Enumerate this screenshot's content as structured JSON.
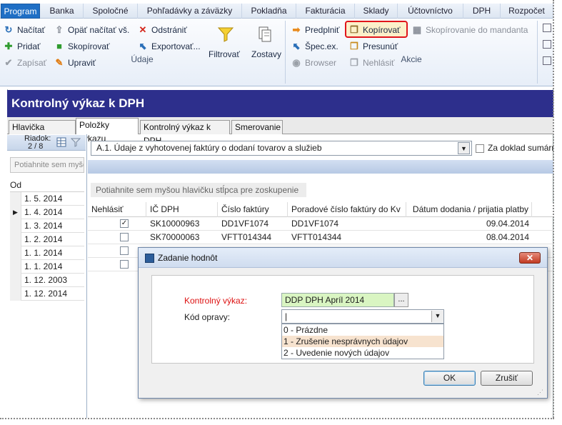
{
  "menu": {
    "tabs": [
      "Program",
      "Banka",
      "Spoločné",
      "Pohľadávky a záväzky",
      "Pokladňa",
      "Fakturácia",
      "Sklady",
      "Účtovníctvo",
      "DPH",
      "Rozpočet"
    ]
  },
  "ribbon": {
    "udaje": {
      "group_label": "Údaje",
      "nacitat": "Načítať",
      "opat_nacitat": "Opäť načítať vš.",
      "odstranit": "Odstrániť",
      "pridat": "Pridať",
      "skopirovat": "Skopírovať",
      "exportovat": "Exportovať...",
      "zapisat": "Zapísať",
      "upravit": "Upraviť",
      "filtrovat": "Filtrovať",
      "zostavy": "Zostavy"
    },
    "akcie": {
      "group_label": "Akcie",
      "predplnit": "Predplniť",
      "kopirovat": "Kopírovať",
      "skopirovanie_mandanta": "Skopírovanie do mandanta",
      "spec_ex": "Špec.ex.",
      "presunut": "Presunúť",
      "browser": "Browser",
      "nehlasit": "Nehlásiť"
    }
  },
  "page": {
    "title": "Kontrolný výkaz k DPH",
    "tabs": [
      "Hlavička výkazu",
      "Položky výkazu",
      "Kontrolný výkaz k DPH",
      "Smerovanie"
    ]
  },
  "left": {
    "row_label": "Riadok:",
    "row_count": "2 / 8",
    "group_hint": "Potiahnite sem myšou",
    "col_header": "Od",
    "rows": [
      "1. 5. 2014",
      "1. 4. 2014",
      "1. 3. 2014",
      "1. 2. 2014",
      "1. 1. 2014",
      "1. 1. 2014",
      "1. 12. 2003",
      "1. 12. 2014"
    ]
  },
  "main": {
    "section_combo": "A.1. Údaje z vyhotovenej faktúry o dodaní tovarov a služieb",
    "summary_checkbox_label": "Za doklad sumárne",
    "group_hint": "Potiahnite sem myšou hlavičku stĺpca pre zoskupenie",
    "columns": [
      "Nehlásiť",
      "IČ DPH",
      "Číslo faktúry",
      "Poradové číslo faktúry do Kv",
      "Dátum dodania / prijatia platby"
    ],
    "rows": [
      {
        "checked": "✓",
        "ic_dph": "SK10000963",
        "cislo": "DD1VF1074",
        "poradove": "DD1VF1074",
        "datum": "09.04.2014"
      },
      {
        "checked": "",
        "ic_dph": "SK70000063",
        "cislo": "VFTT014344",
        "poradove": "VFTT014344",
        "datum": "08.04.2014"
      }
    ]
  },
  "dialog": {
    "title": "Zadanie hodnôt",
    "label_kontrolny_vykaz": "Kontrolný výkaz:",
    "value_kontrolny_vykaz": "DDP DPH Apríl 2014",
    "picker_button": "...",
    "label_kod_opravy": "Kód opravy:",
    "value_kod_opravy": "|",
    "options": [
      "0 - Prázdne",
      "1 - Zrušenie nesprávnych údajov",
      "2 - Uvedenie nových údajov"
    ],
    "ok": "OK",
    "cancel": "Zrušiť",
    "close": "✕"
  }
}
